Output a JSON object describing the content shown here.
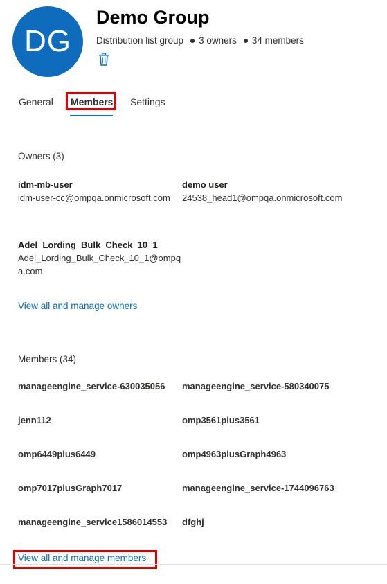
{
  "group": {
    "initials": "DG",
    "name": "Demo Group",
    "type": "Distribution list group",
    "owners_count": "3 owners",
    "members_count": "34 members"
  },
  "tabs": [
    {
      "label": "General"
    },
    {
      "label": "Members"
    },
    {
      "label": "Settings"
    }
  ],
  "owners": {
    "title": "Owners (3)",
    "list": [
      {
        "name": "idm-mb-user",
        "email": "idm-user-cc@ompqa.onmicrosoft.com"
      },
      {
        "name": "demo user",
        "email": "24538_head1@ompqa.onmicrosoft.com"
      },
      {
        "name": "Adel_Lording_Bulk_Check_10_1",
        "email": "Adel_Lording_Bulk_Check_10_1@ompqa.com"
      }
    ],
    "manage_link": "View all and manage owners"
  },
  "members": {
    "title": "Members (34)",
    "list": [
      "manageengine_service-630035056",
      "manageengine_service-580340075",
      "jenn112",
      "omp3561plus3561",
      "omp6449plus6449",
      "omp4963plusGraph4963",
      "omp7017plusGraph7017",
      "manageengine_service-1744096763",
      "manageengine_service1586014553",
      "dfghj"
    ],
    "manage_link": "View all and manage members"
  },
  "colors": {
    "accent": "#0f6cbd",
    "highlight": "#e00000"
  },
  "icons": {
    "delete": "trash-icon"
  }
}
